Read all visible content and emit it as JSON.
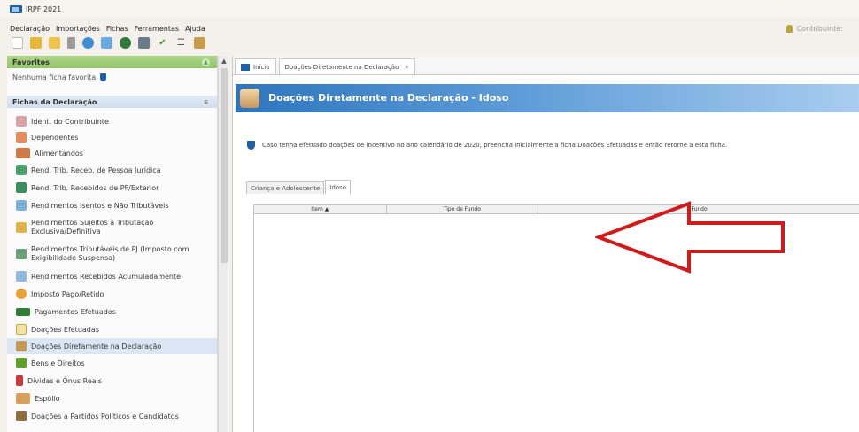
{
  "window": {
    "title": "IRPF 2021"
  },
  "menu": [
    "Declaração",
    "Importações",
    "Fichas",
    "Ferramentas",
    "Ajuda"
  ],
  "contribuinte_label": "Contribuinte:",
  "toolbar": [
    "new-file-icon",
    "open-folder-icon",
    "folder-icon",
    "trash-icon",
    "transmit-icon",
    "receipt-icon",
    "globe-icon",
    "print-icon",
    "check-icon",
    "list-icon",
    "book-icon"
  ],
  "sidebar": {
    "favoritos_title": "Favoritos",
    "favoritos_empty": "Nenhuma ficha favorita",
    "fichas_title": "Fichas da Declaração",
    "items": [
      {
        "label": "Ident. do Contribuinte",
        "icon": "person-icon"
      },
      {
        "label": "Dependentes",
        "icon": "dependents-icon"
      },
      {
        "label": "Alimentandos",
        "icon": "alimentandos-icon"
      },
      {
        "label": "Rend. Trib. Receb. de Pessoa Jurídica",
        "icon": "income-pj-icon"
      },
      {
        "label": "Rend. Trib. Recebidos de PF/Exterior",
        "icon": "income-pf-icon"
      },
      {
        "label": "Rendimentos Isentos e Não Tributáveis",
        "icon": "exempt-icon"
      },
      {
        "label": "Rendimentos Sujeitos à Tributação Exclusiva/Definitiva",
        "icon": "exclusive-tax-icon"
      },
      {
        "label": "Rendimentos Tributáveis de PJ (Imposto com Exigibilidade Suspensa)",
        "icon": "suspended-tax-icon"
      },
      {
        "label": "Rendimentos Recebidos Acumuladamente",
        "icon": "accumulated-icon"
      },
      {
        "label": "Imposto Pago/Retido",
        "icon": "tax-paid-icon"
      },
      {
        "label": "Pagamentos Efetuados",
        "icon": "payments-icon"
      },
      {
        "label": "Doações Efetuadas",
        "icon": "donations-icon"
      },
      {
        "label": "Doações Diretamente na Declaração",
        "icon": "direct-donations-icon"
      },
      {
        "label": "Bens e Direitos",
        "icon": "assets-icon"
      },
      {
        "label": "Dívidas e Ônus Reais",
        "icon": "debts-icon"
      },
      {
        "label": "Espólio",
        "icon": "estate-icon"
      },
      {
        "label": "Doações a Partidos Políticos e Candidatos",
        "icon": "political-donations-icon"
      }
    ]
  },
  "tabs": {
    "home": "Início",
    "current": "Doações Diretamente na Declaração",
    "close": "×"
  },
  "header": {
    "title": "Doações Diretamente na Declaração - Idoso"
  },
  "info": "Caso tenha efetuado doações de incentivo no ano calendário de 2020, preencha inicialmente a ficha Doações Efetuadas e então retorne a esta ficha.",
  "subtabs": [
    "Criança e Adolescente",
    "Idoso"
  ],
  "table": {
    "columns": [
      "Item ▲",
      "Tipo de Fundo",
      "Fundo"
    ]
  },
  "colors": {
    "accent": "#1f5fa8",
    "favoritos": "#9ccc73",
    "arrow": "#d11b1b",
    "selected": "#dbe7f5"
  }
}
